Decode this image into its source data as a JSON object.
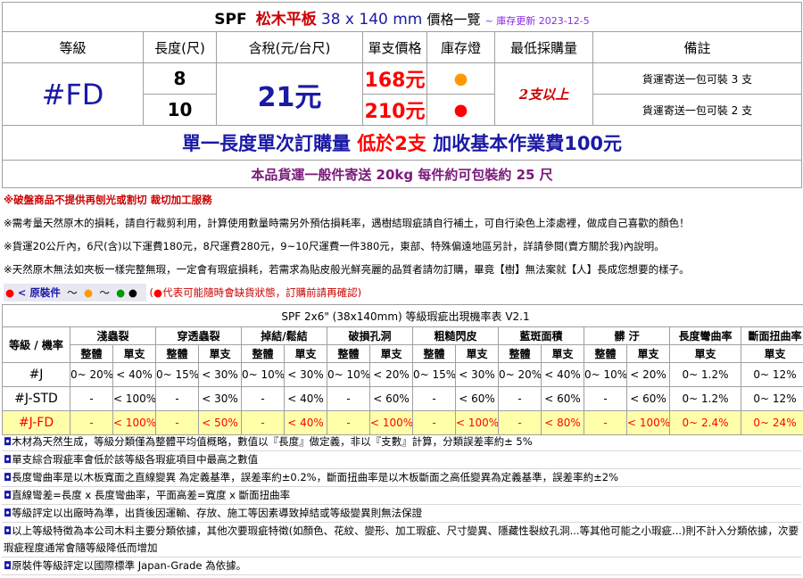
{
  "header": {
    "brand": "SPF",
    "product": "松木平板",
    "size": "38 x 140 mm",
    "list_label": "價格一覽",
    "updated": "~ 庫存更新 2023-12-5"
  },
  "columns": [
    "等級",
    "長度(尺)",
    "含稅(元/台尺)",
    "單支價格",
    "庫存燈",
    "最低採購量",
    "備註"
  ],
  "product_row": {
    "grade": "#FD",
    "rate": "21元",
    "min_order": "2支以上",
    "variants": [
      {
        "length": "8",
        "price": "168元",
        "stock_dot": "●",
        "stock_color": "#ff9900",
        "remark": "貨運寄送一包可裝 3 支"
      },
      {
        "length": "10",
        "price": "210元",
        "stock_dot": "●",
        "stock_color": "#ff0000",
        "remark": "貨運寄送一包可裝 2 支"
      }
    ]
  },
  "banner1": {
    "part1": "單一長度單次訂購量",
    "part2": "低於2支",
    "part3": "加收基本作業費100元"
  },
  "banner2": "本品貨運一般件寄送 20kg 每件約可包裝約 25 尺",
  "notices": [
    "※破盤商品不提供再刨光或割切 裁切加工服務",
    "※需考量天然原木的損耗，請自行裁剪利用，計算使用數量時需另外預估損耗率，遇樹結瑕疵請自行補土，可自行染色上漆處裡，做成自己喜歡的顏色！",
    "※貨運20公斤內，6尺(含)以下運費180元，8尺運費280元，9~10尺運費一件380元，東部、特殊偏遠地區另計，詳請參閱(賣方關於我)內說明。",
    "※天然原木無法如夾板一樣完整無瑕，一定會有瑕疵損耗，若需求為貼皮般光鮮亮麗的品質者請勿訂購，畢竟【樹】無法案就【人】長成您想要的樣子。"
  ],
  "legend": {
    "label": "< 原裝件",
    "tilde": "～",
    "end_dot": "●",
    "note": "代表可能隨時會缺貨狀態，訂購前請再確認",
    "open": "(",
    "close": ")",
    "colors": {
      "red": "#ff0000",
      "orange": "#ff9900",
      "green": "#009900"
    }
  },
  "defect_table": {
    "title": "SPF 2x6\" (38x140mm) 等級瑕疵出現機率表 V2.1",
    "grade_header": "等級 / 機率",
    "groups": [
      "淺蟲裂",
      "穿透蟲裂",
      "掉結/鬆結",
      "破損孔洞",
      "粗糙閃皮",
      "藍斑面積",
      "髒 汙",
      "長度彎曲率",
      "斷面扭曲率"
    ],
    "sub_whole": "整體",
    "sub_single": "單支",
    "rows": [
      {
        "grade": "#J",
        "cells": [
          "0~ 20%",
          "< 40%",
          "0~ 15%",
          "< 30%",
          "0~ 10%",
          "< 30%",
          "0~ 10%",
          "< 20%",
          "0~ 15%",
          "< 30%",
          "0~ 20%",
          "< 40%",
          "0~ 10%",
          "< 20%",
          "0~ 1.2%",
          "0~ 12%"
        ]
      },
      {
        "grade": "#J-STD",
        "cells": [
          "-",
          "< 100%",
          "-",
          "< 30%",
          "-",
          "< 40%",
          "-",
          "< 60%",
          "-",
          "< 60%",
          "-",
          "< 60%",
          "-",
          "< 60%",
          "0~ 1.2%",
          "0~ 12%"
        ]
      },
      {
        "grade": "#J-FD",
        "cells": [
          "-",
          "< 100%",
          "-",
          "< 50%",
          "-",
          "< 40%",
          "-",
          "< 100%",
          "-",
          "< 100%",
          "-",
          "< 80%",
          "-",
          "< 100%",
          "0~ 2.4%",
          "0~ 24%"
        ]
      }
    ]
  },
  "footnotes": [
    "木材為天然生成，等級分類僅為整體平均值概略，數值以『長度』做定義，非以『支數』計算，分類誤差率約± 5%",
    "單支綜合瑕疵率會低於該等級各瑕疵項目中最高之數值",
    "長度彎曲率是以木板寬面之直線變異 為定義基準，誤差率約±0.2%，斷面扭曲率是以木板斷面之高低變異為定義基準，誤差率約±2%",
    "直線彎差=長度 x 長度彎曲率，平面高差=寬度 x 斷面扭曲率",
    "等級評定以出廠時為準，出貨後因運輸、存放、施工等因素導致掉結或等級變異則無法保證",
    "以上等級特徵為本公司木料主要分類依據，其他次要瑕疵特徵(如顏色、花紋、變形、加工瑕疵、尺寸變異、隱藏性裂紋孔洞...等其他可能之小瑕疵...)則不計入分類依據，次要瑕疵程度通常會隨等級降低而增加",
    "原裝件等級評定以國際標準 Japan-Grade 為依據。"
  ],
  "footnote_bullet": "◘"
}
